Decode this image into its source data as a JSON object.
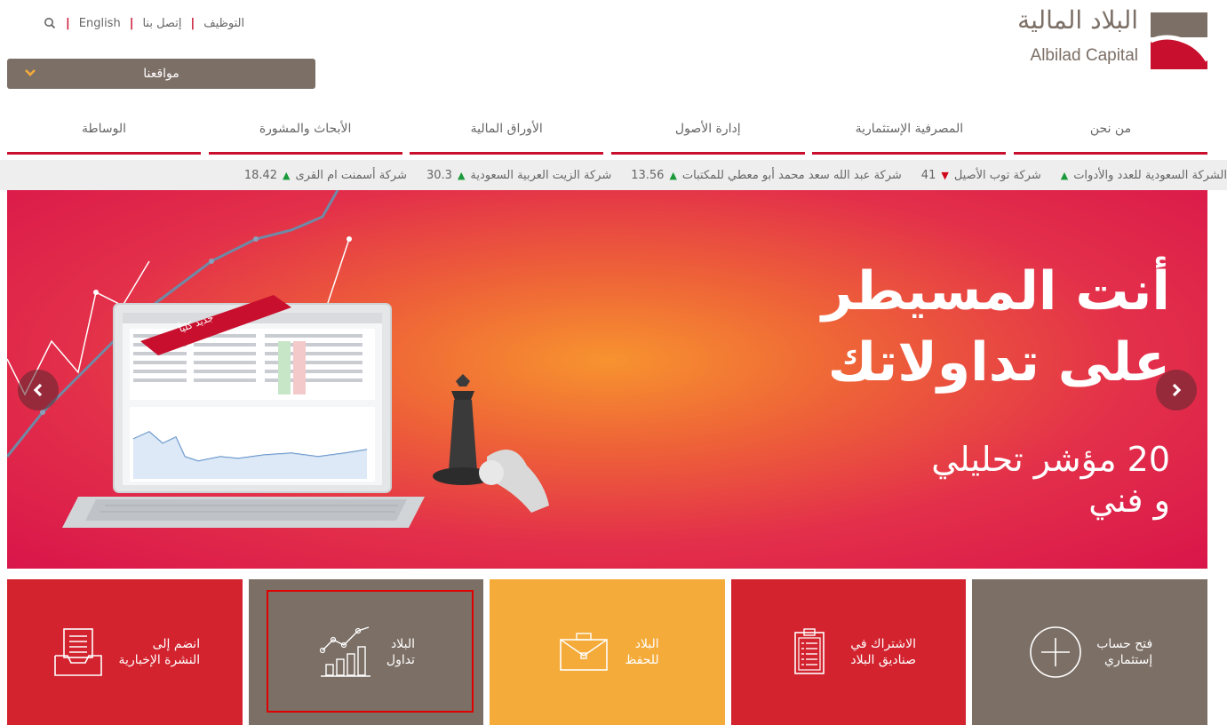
{
  "header": {
    "logo_ar": "البلاد المالية",
    "logo_en": "Albilad Capital",
    "top_links": {
      "careers": "التوظيف",
      "contact": "إتصل بنا",
      "language": "English"
    },
    "locations_label": "مواقعنا"
  },
  "nav": {
    "items": [
      {
        "label": "من نحن"
      },
      {
        "label": "المصرفية الإستثمارية"
      },
      {
        "label": "إدارة الأصول"
      },
      {
        "label": "الأوراق المالية"
      },
      {
        "label": "الأبحاث والمشورة"
      },
      {
        "label": "الوساطة"
      }
    ]
  },
  "ticker": {
    "items": [
      {
        "name": "شركة أسمنت ام القرى",
        "value": "18.42",
        "direction": "up"
      },
      {
        "name": "شركة الزيت العربية السعودية",
        "value": "30.3",
        "direction": "up"
      },
      {
        "name": "شركة عبد الله سعد محمد أبو معطي للمكتبات",
        "value": "13.56",
        "direction": "up"
      },
      {
        "name": "شركة توب الأصيل",
        "value": "41",
        "direction": "down"
      },
      {
        "name": "الشركة السعودية للعدد والأدوات",
        "value": "",
        "direction": "up"
      }
    ]
  },
  "hero": {
    "title_line1": "أنت المسيطر",
    "title_line2": "على تداولاتك",
    "subtitle_line1": "20 مؤشر تحليلي",
    "subtitle_line2": "و فني",
    "ribbon": "جديد كلياً"
  },
  "tiles": [
    {
      "label": "فتح حساب\nإستثماري",
      "icon": "plus-circle-icon",
      "color": "#7c6f66"
    },
    {
      "label": "الاشتراك في\nصناديق البلاد",
      "icon": "clipboard-list-icon",
      "color": "#d2232e"
    },
    {
      "label": "البلاد\nللحفظ",
      "icon": "briefcase-icon",
      "color": "#f4ab3a"
    },
    {
      "label": "البلاد\nتداول",
      "icon": "trading-chart-icon",
      "color": "#7c6f66"
    },
    {
      "label": "انضم إلى\nالنشرة الإخبارية",
      "icon": "newsletter-inbox-icon",
      "color": "#d2232e"
    }
  ],
  "colors": {
    "brand_red": "#c8102e",
    "brand_brown": "#7c6f66",
    "brand_yellow": "#f4ab3a",
    "tick_up": "#1a9a3a",
    "tick_down": "#d0021b"
  }
}
